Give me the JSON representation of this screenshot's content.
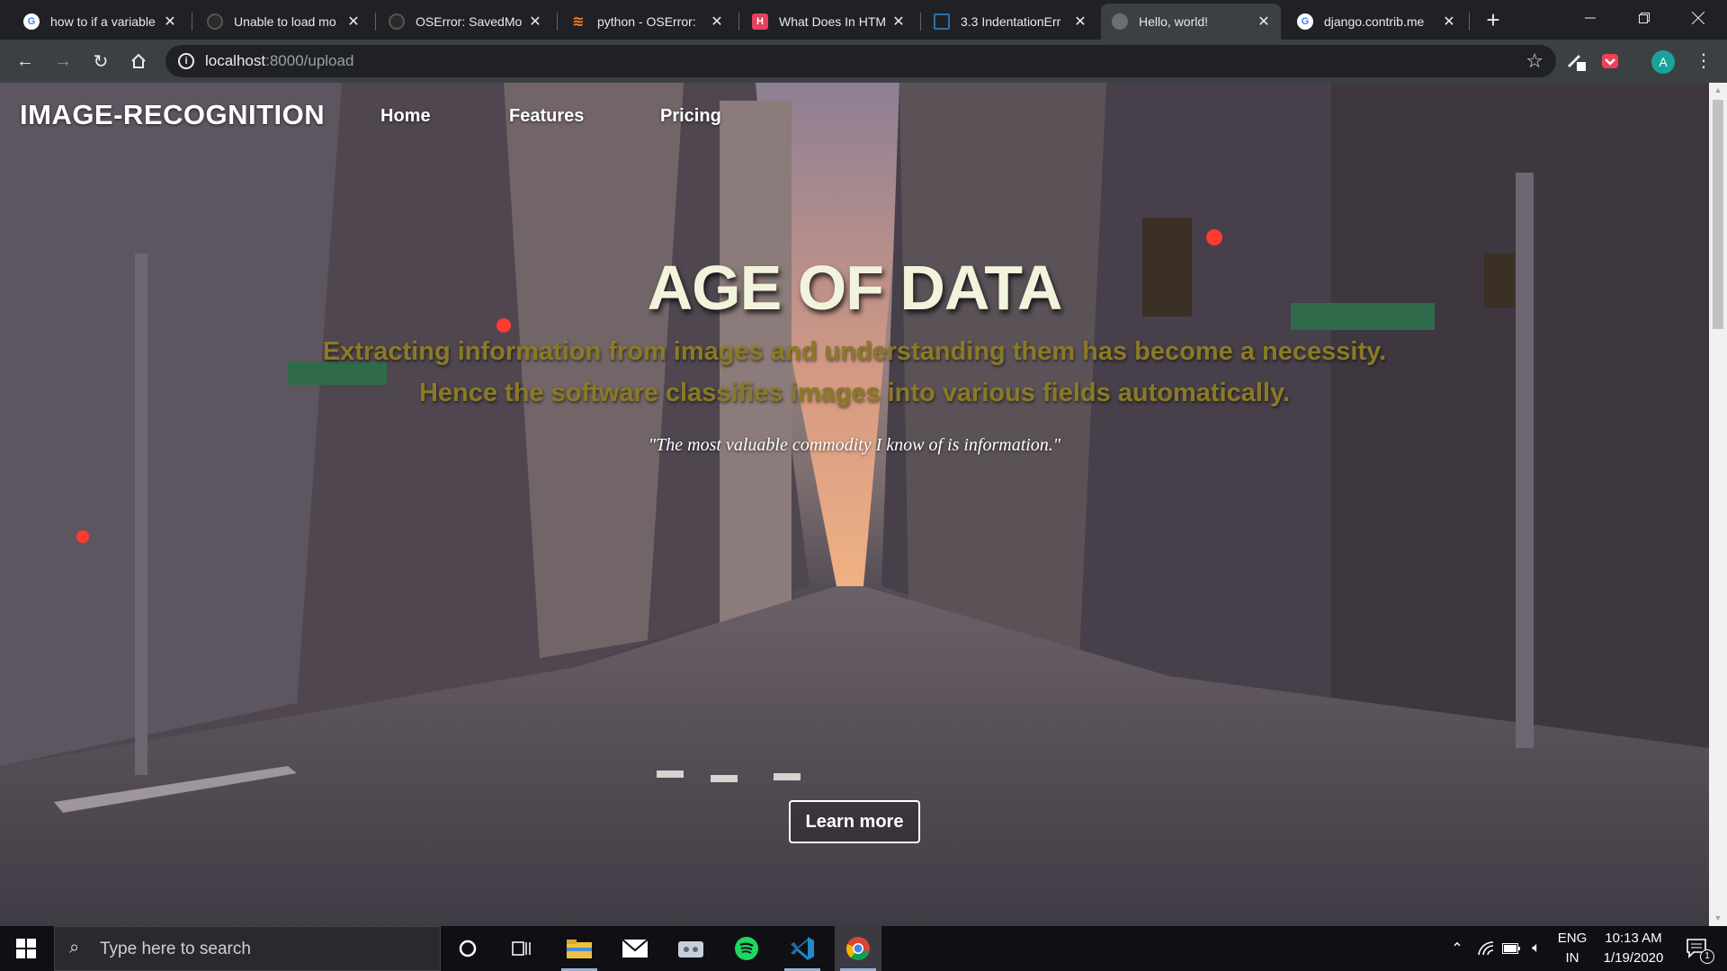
{
  "browser": {
    "tabs": [
      {
        "title": "how to if a variable",
        "favicon": "google-icon",
        "active": false
      },
      {
        "title": "Unable to load mo",
        "favicon": "github-icon",
        "active": false
      },
      {
        "title": "OSError: SavedMo",
        "favicon": "github-icon",
        "active": false
      },
      {
        "title": "python - OSError:",
        "favicon": "stackoverflow-icon",
        "active": false
      },
      {
        "title": "What Does In HTM",
        "favicon": "h-icon",
        "active": false
      },
      {
        "title": "3.3 IndentationErr",
        "favicon": "doc-icon",
        "active": false
      },
      {
        "title": "Hello, world!",
        "favicon": "globe-icon",
        "active": true
      },
      {
        "title": "django.contrib.me",
        "favicon": "google-icon",
        "active": false
      }
    ],
    "address": {
      "host": "localhost",
      "path": ":8000/upload"
    },
    "profile_initial": "A"
  },
  "site": {
    "brand": "IMAGE-RECOGNITION",
    "nav": [
      "Home",
      "Features",
      "Pricing"
    ],
    "hero": {
      "title": "AGE OF DATA",
      "subtitle_line1": "Extracting information from images and understanding them has become a necessity.",
      "subtitle_line2": "Hence the software classifies images into various fields automatically.",
      "quote": "\"The most valuable commodity I know of is information.\"",
      "cta": "Learn more"
    }
  },
  "taskbar": {
    "search_placeholder": "Type here to search",
    "lang_line1": "ENG",
    "lang_line2": "IN",
    "time": "10:13 AM",
    "date": "1/19/2020",
    "notification_count": "1"
  },
  "colors": {
    "hero_title": "#f2f3dc",
    "hero_subtitle": "#8a7a25",
    "chrome_dark": "#202124",
    "chrome_toolbar": "#3c4043"
  }
}
